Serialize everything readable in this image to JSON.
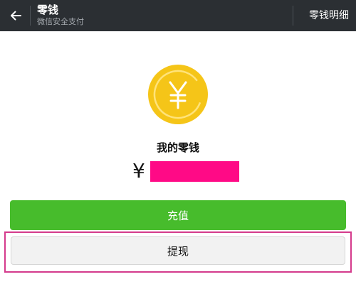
{
  "navbar": {
    "back_icon": "arrow-left-icon",
    "title": "零钱",
    "subtitle": "微信安全支付",
    "action_label": "零钱明细"
  },
  "balance": {
    "coin_icon": "yuan-coin-icon",
    "label": "我的零钱",
    "currency_symbol": "¥"
  },
  "buttons": {
    "recharge_label": "充值",
    "withdraw_label": "提现"
  },
  "colors": {
    "navbar_bg": "#2b2f33",
    "coin": "#f5c518",
    "recharge_bg": "#47bc2c",
    "highlight_border": "#d43a8c",
    "redaction": "#ff0a86"
  }
}
